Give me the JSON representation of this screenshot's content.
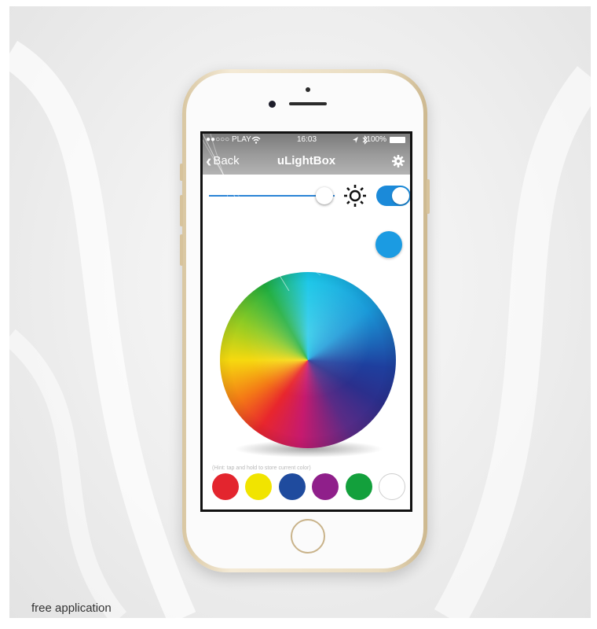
{
  "caption": "free application",
  "status": {
    "carrier": "●●○○○ PLAY",
    "time": "16:03",
    "battery": "100%"
  },
  "nav": {
    "back_label": "Back",
    "title": "uLightBox"
  },
  "brightness": {
    "value": 0.92,
    "enabled": true
  },
  "current_color": "#1B9BE2",
  "hint": "(Hint: tap and hold to store current color)",
  "swatches": [
    {
      "name": "red",
      "color": "#E3252E"
    },
    {
      "name": "yellow",
      "color": "#F1E400"
    },
    {
      "name": "blue",
      "color": "#1F4B9E"
    },
    {
      "name": "purple",
      "color": "#8F1F8A"
    },
    {
      "name": "green",
      "color": "#13A03C"
    },
    {
      "name": "white",
      "color": "#FFFFFF"
    }
  ],
  "icons": {
    "back": "chevron-left-icon",
    "settings": "gear-icon",
    "brightness": "sun-icon",
    "wifi": "wifi-icon",
    "location": "location-arrow-icon",
    "bluetooth": "bluetooth-icon"
  }
}
